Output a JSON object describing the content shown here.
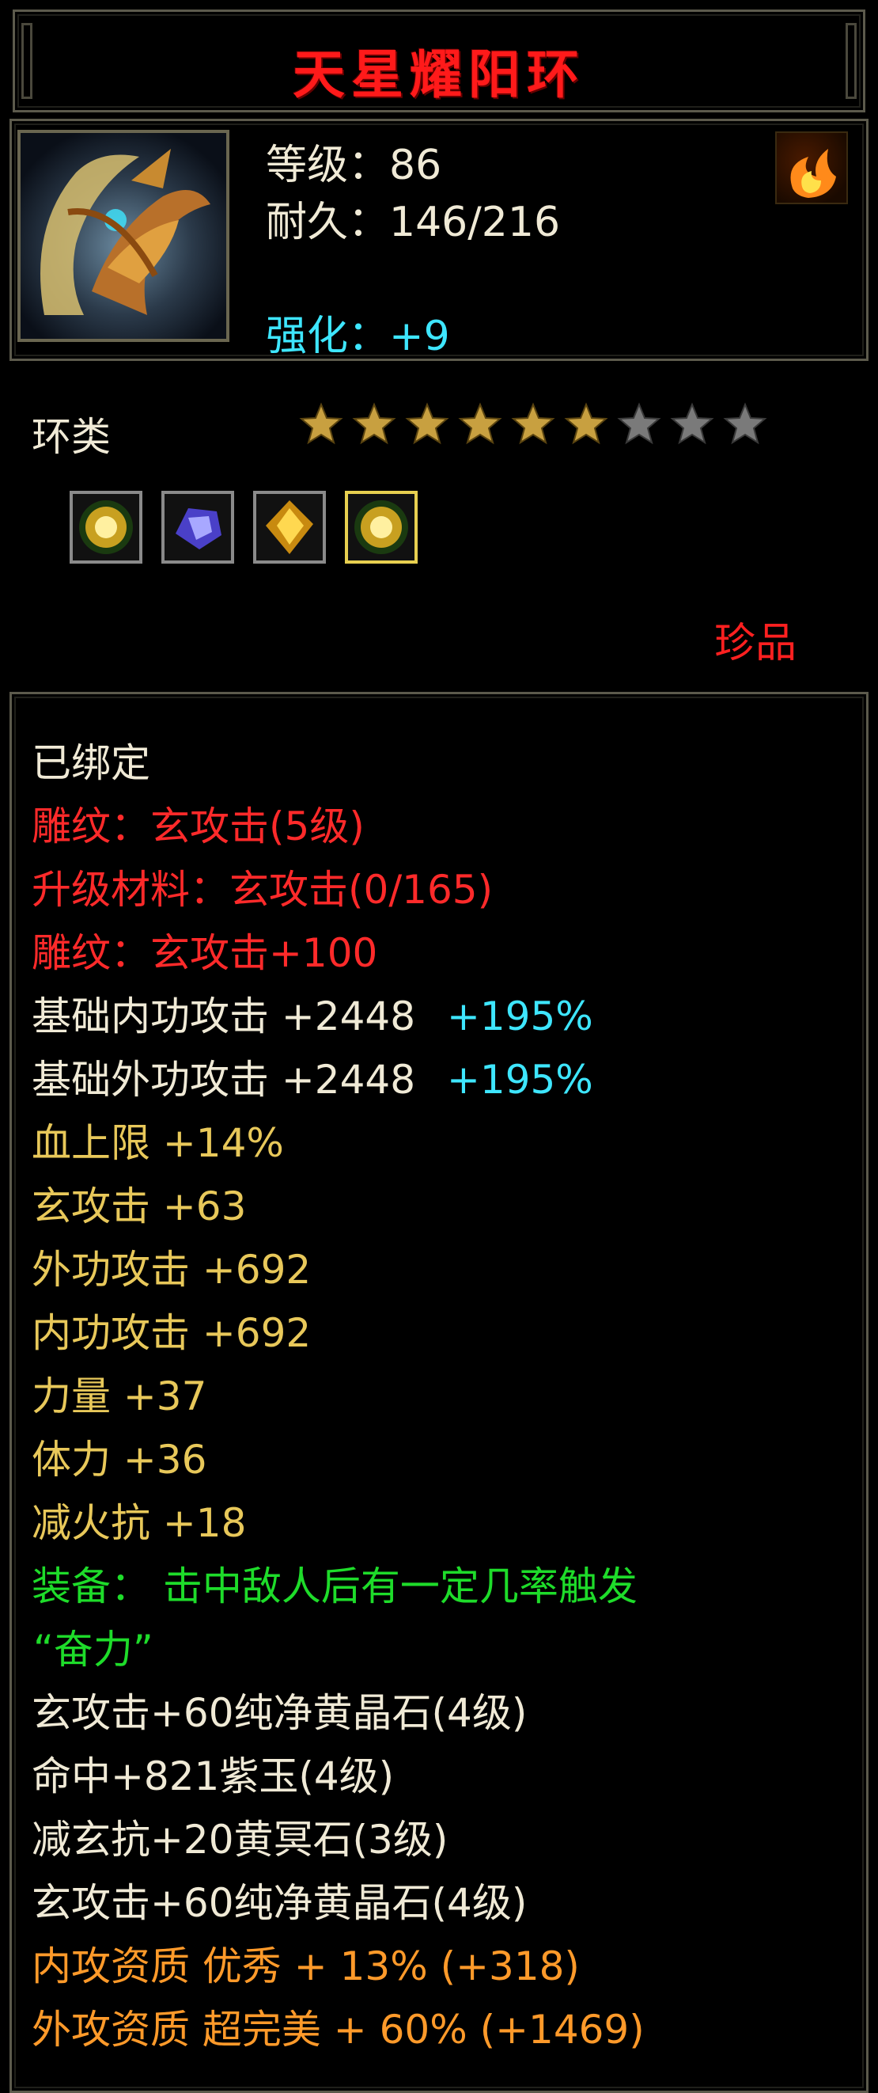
{
  "title": "天星耀阳环",
  "header": {
    "level": "等级：86",
    "durability": "耐久：146/216",
    "enhance": "强化：+9"
  },
  "item_type": "环类",
  "stars": {
    "filled": 6,
    "total": 9
  },
  "sockets": [
    {
      "icon": "green-gold-gem-icon"
    },
    {
      "icon": "purple-jade-gem-icon"
    },
    {
      "icon": "yellow-crystal-gem-icon"
    },
    {
      "icon": "green-gold-gem-icon",
      "selected": true
    }
  ],
  "rarity": "珍品",
  "colors": {
    "red": "#ff2a2a",
    "gold": "#e8c85a",
    "green": "#1edc2a",
    "orange": "#ff9a2a",
    "cyan": "#3ee6ff"
  },
  "details": {
    "bound": "已绑定",
    "carve1": "雕纹：玄攻击(5级)",
    "upgrade_material": "升级材料：玄攻击(0/165)",
    "carve2": "雕纹：玄攻击+100",
    "base_inner_attack": "基础内功攻击 +2448",
    "base_inner_pct": "+195%",
    "base_outer_attack": "基础外功攻击 +2448",
    "base_outer_pct": "+195%",
    "hp_limit": "血上限 +14%",
    "mystic_attack": "玄攻击 +63",
    "outer_attack": "外功攻击 +692",
    "inner_attack": "内功攻击 +692",
    "strength": "力量 +37",
    "stamina": "体力 +36",
    "fire_resist_reduce": "减火抗 +18",
    "equip_effect_1": "装备： 击中敌人后有一定几率触发",
    "equip_effect_2": "“奋力”",
    "gem1": "玄攻击+60纯净黄晶石(4级)",
    "gem2": "命中+821紫玉(4级)",
    "gem3": "减玄抗+20黄冥石(3级)",
    "gem4": "玄攻击+60纯净黄晶石(4级)",
    "inner_quality": "内攻资质 优秀 + 13% (+318)",
    "outer_quality": "外攻资质 超完美 + 60% (+1469)"
  }
}
